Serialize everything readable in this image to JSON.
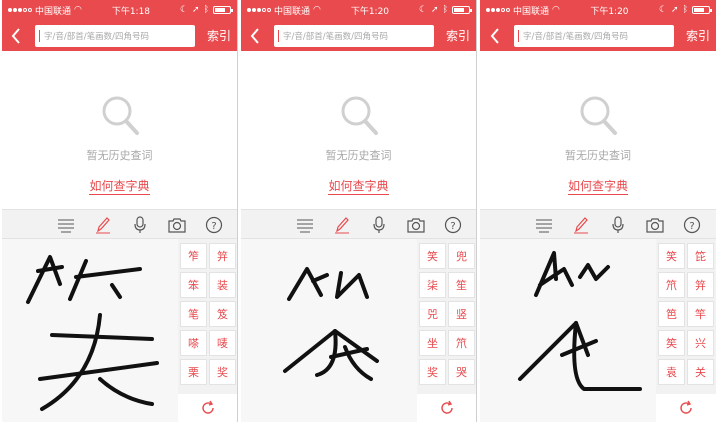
{
  "colors": {
    "accent": "#e84a4d",
    "ink": "#111111",
    "muted": "#a8a8a8"
  },
  "screens": [
    {
      "status": {
        "carrier": "中国联通",
        "time": "下午1:18"
      },
      "nav": {
        "back_icon": "chevron-left-icon",
        "search_placeholder": "字/音/部首/笔画数/四角号码",
        "index_label": "索引"
      },
      "empty": {
        "text": "暂无历史查词",
        "help_link": "如何查字典"
      },
      "candidates": [
        "笮",
        "笄",
        "笨",
        "装",
        "笔",
        "笈",
        "嗏",
        "唛",
        "栗",
        "奖"
      ]
    },
    {
      "status": {
        "carrier": "中国联通",
        "time": "下午1:20"
      },
      "nav": {
        "back_icon": "chevron-left-icon",
        "search_placeholder": "字/音/部首/笔画数/四角号码",
        "index_label": "索引"
      },
      "empty": {
        "text": "暂无历史查词",
        "help_link": "如何查字典"
      },
      "candidates": [
        "笑",
        "兜",
        "柒",
        "笙",
        "兕",
        "竖",
        "坐",
        "笊",
        "奖",
        "哭"
      ]
    },
    {
      "status": {
        "carrier": "中国联通",
        "time": "下午1:20"
      },
      "nav": {
        "back_icon": "chevron-left-icon",
        "search_placeholder": "字/音/部首/笔画数/四角号码",
        "index_label": "索引"
      },
      "empty": {
        "text": "暂无历史查词",
        "help_link": "如何查字典"
      },
      "candidates": [
        "笑",
        "笓",
        "笊",
        "笄",
        "笆",
        "竿",
        "笶",
        "兴",
        "袁",
        "关"
      ]
    }
  ]
}
